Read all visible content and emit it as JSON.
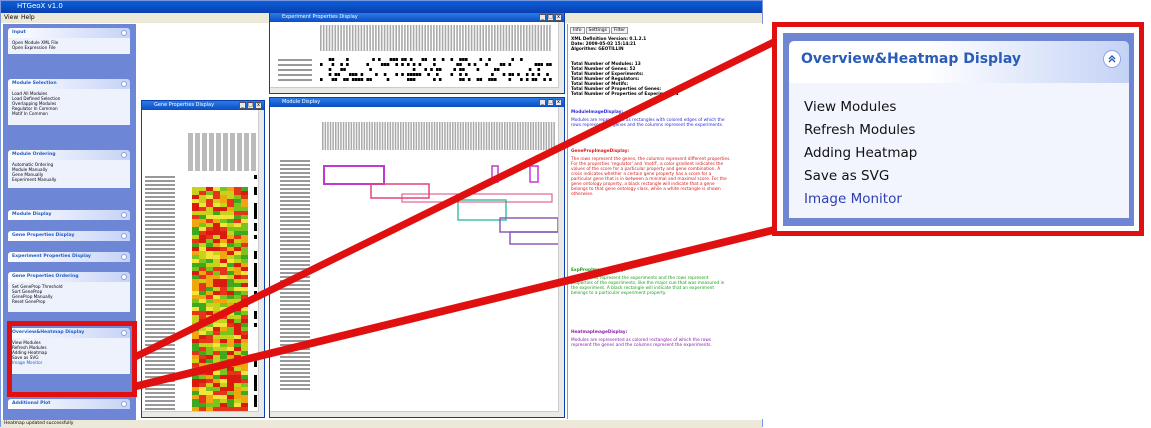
{
  "app": {
    "title": "HTGeoX v1.0",
    "menu": [
      "View",
      "Help"
    ],
    "status": "Heatmap updated successfully"
  },
  "sidebar": {
    "panels": [
      {
        "title": "Input",
        "items": [
          "Open Module XML File",
          "Open Expression File"
        ]
      },
      {
        "title": "Module Selection",
        "items": [
          "Load All Modules",
          "Load Defined Selection",
          "Overlapping Modules",
          "Regulator In Common",
          "Motif In Common"
        ]
      },
      {
        "title": "Module Ordering",
        "items": [
          "Automatic Ordering",
          "Module Manually",
          "Gene Manually",
          "Experiment Manually"
        ]
      },
      {
        "title": "Module Display",
        "items": []
      },
      {
        "title": "Gene Properties Display",
        "items": []
      },
      {
        "title": "Experiment Properties Display",
        "items": []
      },
      {
        "title": "Gene Properties Ordering",
        "items": [
          "Set GeneProp Threshold",
          "Sort GeneProp",
          "GeneProp Manually",
          "Reset GeneProp"
        ]
      },
      {
        "title": "Overview&Heatmap Display",
        "items": [
          "View Modules",
          "Refresh Modules",
          "Adding Heatmap",
          "Save as SVG",
          "Image Monitor"
        ]
      },
      {
        "title": "Additional Plot",
        "items": []
      }
    ]
  },
  "windows": {
    "experiment": {
      "title": "Experiment Properties Display"
    },
    "gene": {
      "title": "Gene Properties Display"
    },
    "module": {
      "title": "Module Display"
    }
  },
  "info": {
    "tabs": [
      "Info",
      "Settings",
      "Filter"
    ],
    "header": [
      "XML Definition Version: 0.1.2.1",
      "Date: 2009-05-02 15:14:21",
      "Algorithm: GEOTILLIN"
    ],
    "stats": [
      "Total Number of Modules: 13",
      "Total Number of Genes: 52",
      "Total Number of Experiments:",
      "Total Number of Regulators:",
      "Total Number of Motifs:",
      "Total Number of Properties of Genes:",
      "Total Number of Properties of Experiment: 4"
    ],
    "sections": [
      {
        "heading": "ModuleImageDisplay:",
        "text": "Modules are represented as rectangles with colored edges of which the rows represent the genes and the columns represent the experiments.",
        "color": "#2b2bd8"
      },
      {
        "heading": "GenePropImageDisplay:",
        "text": "The rows represent the genes, the columns represent different properties. For the properties 'regulator' and 'motif', a color gradient indicates the values of the score for a particular property and gene combination. A cross indicates whether a certain gene property has a score for a particular gene that is in between a minimal and maximal score. For the gene ontology property, a black rectangle will indicate that a gene belongs to that gene ontology class, while a white rectangle is shown otherwise.",
        "color": "#d61c1c"
      },
      {
        "heading": "ExpPropImageDisplay:",
        "text": "The columns represent the experiments and the rows represent properties of the experiments, like the major cue that was measured in the experiment. A black rectangle will indicate that an experiment belongs to a particular experiment property.",
        "color": "#1f9e1f"
      },
      {
        "heading": "HeatmapImageDisplay:",
        "text": "Modules are represented as colored rectangles of which the rows represent the genes and the columns represent the experiments.",
        "color": "#8a1fa8"
      }
    ]
  },
  "callout": {
    "title": "Overview&Heatmap Display",
    "items": [
      "View Modules",
      "Refresh Modules",
      "Adding Heatmap",
      "Save as SVG",
      "Image Monitor"
    ],
    "link_color": "#2d3fb5",
    "highlight_color": "#e01010"
  }
}
